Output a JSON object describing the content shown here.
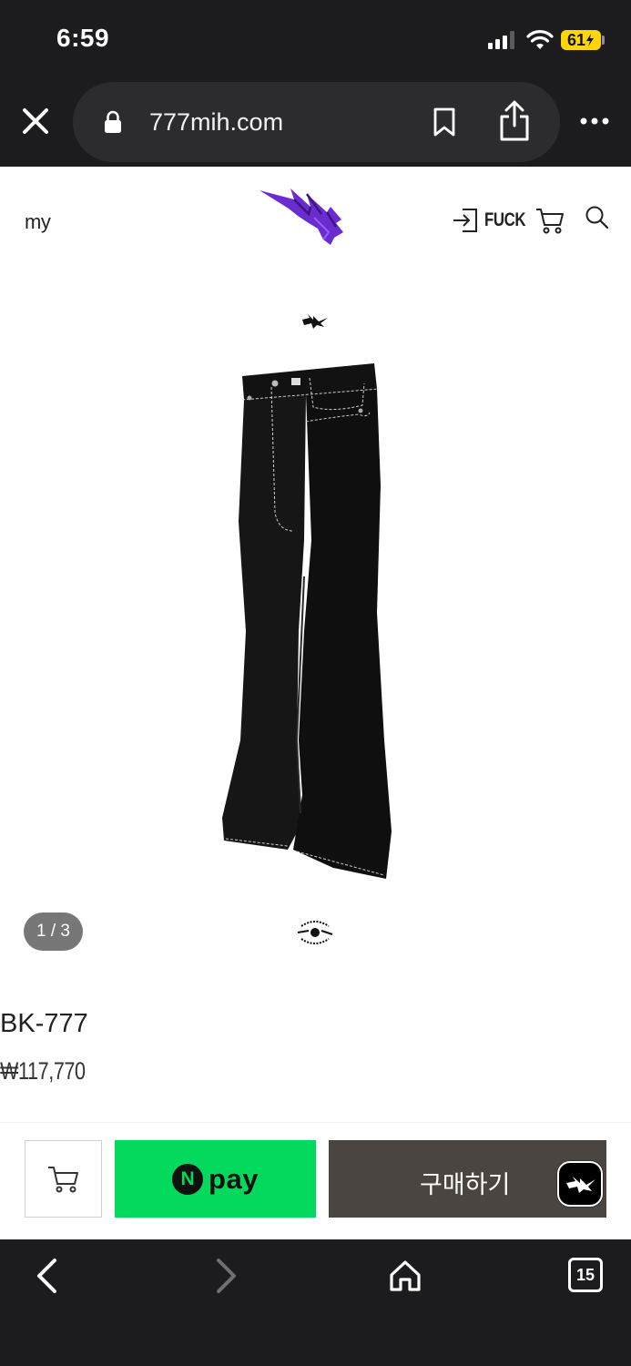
{
  "status_bar": {
    "time": "6:59",
    "battery": "61"
  },
  "browser": {
    "url": "777mih.com",
    "tab_count": "15"
  },
  "header": {
    "my_label": "my",
    "login_label": "FUCK"
  },
  "product": {
    "image_counter": "1 / 3",
    "name": "BK-777",
    "price": "₩117,770"
  },
  "actions": {
    "npay_n": "N",
    "npay_label": "pay",
    "buy_label": "구매하기"
  },
  "colors": {
    "npay_green": "#03d95c",
    "buy_brown": "#4a4540",
    "browser_dark": "#1c1c1e",
    "battery_yellow": "#ffd60a",
    "logo_purple": "#6a2ccf"
  }
}
